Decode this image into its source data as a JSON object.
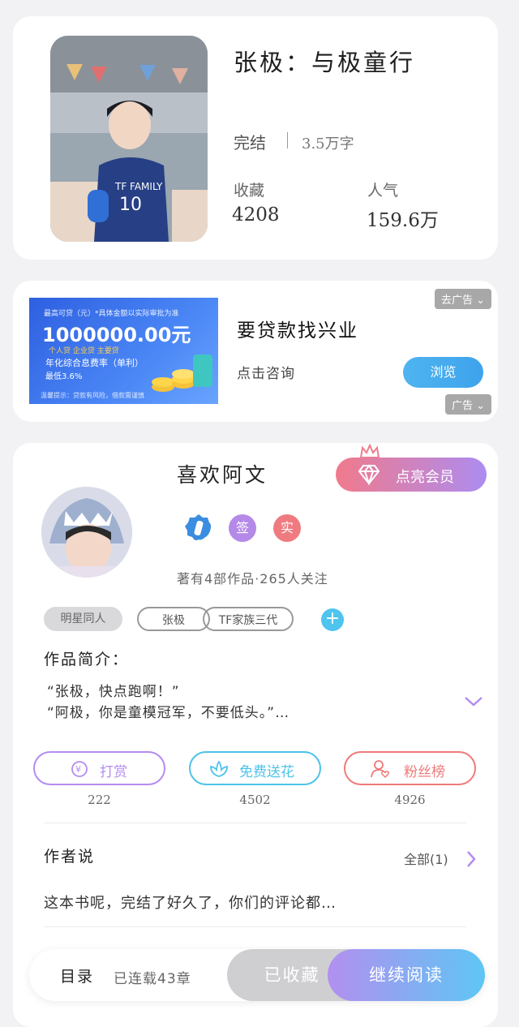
{
  "book": {
    "title": "张极：与极童行",
    "status": "完结",
    "word_count": "3.5万字",
    "favorites_label": "收藏",
    "favorites_value": "4208",
    "popularity_label": "人气",
    "popularity_value": "159.6万"
  },
  "ad": {
    "image_text": {
      "line1": "最高可贷（元）*具体金额以实际审批为准",
      "amount": "1000000.00元",
      "tags": "个人贷  企业贷  主要贷",
      "rate_label": "年化综合息费率（单利）",
      "rate_value": "最低3.6%",
      "disclaimer": "温馨提示：贷款有风险，借款需谨慎"
    },
    "top_tag": "去广告 ⌄",
    "title": "要贷款找兴业",
    "subtitle": "点击咨询",
    "button": "浏览",
    "bottom_tag": "广告 ⌄"
  },
  "author": {
    "name": "喜欢阿文",
    "vip_button": "点亮会员",
    "badges": [
      "签",
      "实"
    ],
    "works_info": "著有4部作品·265人关注",
    "tags": [
      "明星同人",
      "张极",
      "TF家族三代"
    ],
    "intro_label": "作品简介：",
    "intro_lines": [
      "“张极，快点跑啊！”",
      "“阿极，你是童模冠军，不要低头。”…"
    ],
    "actions": [
      {
        "label": "打赏",
        "count": "222",
        "color": "#b48cf0"
      },
      {
        "label": "免费送花",
        "count": "4502",
        "color": "#4cc3e8"
      },
      {
        "label": "粉丝榜",
        "count": "4926",
        "color": "#ef7a7a"
      }
    ],
    "author_says_title": "作者说",
    "author_says_all": "全部(1)",
    "author_says_text": "这本书呢，完结了好久了，你们的评论都…"
  },
  "bottom": {
    "toc": "目录",
    "serial": "已连载43章",
    "collected": "已收藏",
    "continue": "继续阅读"
  }
}
